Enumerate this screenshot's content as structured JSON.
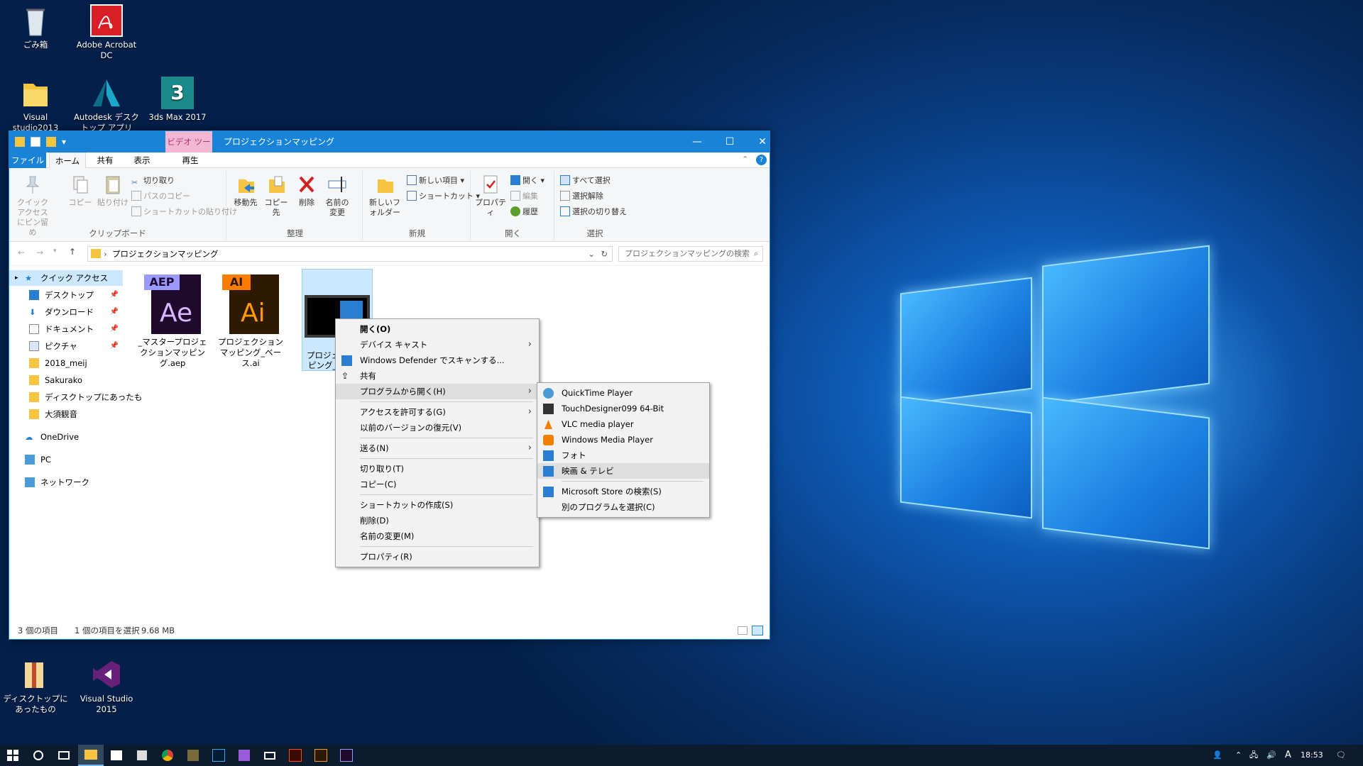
{
  "desktop": {
    "icons": [
      {
        "label": "ごみ箱",
        "icon": "recycle-bin-icon"
      },
      {
        "label": "Adobe Acrobat DC",
        "icon": "acrobat-icon"
      },
      {
        "label": "Visual studio2013",
        "icon": "folder-icon"
      },
      {
        "label": "Autodesk デスクトップ アプリ",
        "icon": "autodesk-icon"
      },
      {
        "label": "3ds Max 2017",
        "icon": "3dsmax-icon"
      },
      {
        "label": "ディスクトップにあったもの",
        "icon": "zip-folder-icon"
      },
      {
        "label": "Visual Studio 2015",
        "icon": "visual-studio-icon"
      }
    ]
  },
  "explorer": {
    "contextual_tab": "ビデオ ツール",
    "title": "プロジェクションマッピング",
    "tabs": [
      "ファイル",
      "ホーム",
      "共有",
      "表示",
      "再生"
    ],
    "ribbon": {
      "clipboard": {
        "label": "クリップボード",
        "pin": "クイック アクセスにピン留め",
        "copy": "コピー",
        "paste": "貼り付け",
        "cut": "切り取り",
        "copy_path": "パスのコピー",
        "paste_shortcut": "ショートカットの貼り付け"
      },
      "organize": {
        "label": "整理",
        "move_to": "移動先",
        "copy_to": "コピー先",
        "delete": "削除",
        "rename": "名前の変更"
      },
      "new": {
        "label": "新規",
        "new_folder": "新しいフォルダー",
        "new_item": "新しい項目",
        "shortcut": "ショートカット"
      },
      "open": {
        "label": "開く",
        "properties": "プロパティ",
        "open": "開く",
        "edit": "編集",
        "history": "履歴"
      },
      "select": {
        "label": "選択",
        "select_all": "すべて選択",
        "select_none": "選択解除",
        "invert": "選択の切り替え"
      }
    },
    "address": "プロジェクションマッピング",
    "search_placeholder": "プロジェクションマッピングの検索",
    "nav": [
      {
        "label": "クイック アクセス"
      },
      {
        "label": "デスクトップ"
      },
      {
        "label": "ダウンロード"
      },
      {
        "label": "ドキュメント"
      },
      {
        "label": "ピクチャ"
      },
      {
        "label": "2018_meij"
      },
      {
        "label": "Sakurako"
      },
      {
        "label": "ディスクトップにあったも"
      },
      {
        "label": "大須観音"
      },
      {
        "label": "OneDrive"
      },
      {
        "label": "PC"
      },
      {
        "label": "ネットワーク"
      }
    ],
    "files": [
      {
        "name": "_マスタープロジェクションマッピング.aep",
        "badge": "AEP",
        "glyph": "Ae"
      },
      {
        "name": "プロジェクションマッピング_ベース.ai",
        "badge": "AI",
        "glyph": "Ai"
      },
      {
        "name": "プロジェクションマッピング_マ...mov",
        "name_lines": [
          "プロジェクシ",
          "ピング_マ",
          "mo"
        ]
      }
    ],
    "status": {
      "count": "3 個の項目",
      "selected": "1 個の項目を選択",
      "size": "9.68 MB"
    }
  },
  "context_menu": [
    {
      "label": "開く(O)",
      "bold": true
    },
    {
      "label": "デバイス キャスト",
      "submenu": true
    },
    {
      "label": "Windows Defender でスキャンする...",
      "icon": "defender-icon"
    },
    {
      "label": "共有",
      "icon": "share-icon"
    },
    {
      "label": "プログラムから開く(H)",
      "submenu": true
    },
    {
      "label": "アクセスを許可する(G)",
      "submenu": true
    },
    {
      "label": "以前のバージョンの復元(V)"
    },
    {
      "label": "送る(N)",
      "submenu": true
    },
    {
      "label": "切り取り(T)"
    },
    {
      "label": "コピー(C)"
    },
    {
      "label": "ショートカットの作成(S)"
    },
    {
      "label": "削除(D)"
    },
    {
      "label": "名前の変更(M)"
    },
    {
      "label": "プロパティ(R)"
    }
  ],
  "submenu": [
    {
      "label": "QuickTime Player",
      "icon": "quicktime-icon"
    },
    {
      "label": "TouchDesigner099 64-Bit",
      "icon": "touchdesigner-icon"
    },
    {
      "label": "VLC media player",
      "icon": "vlc-icon"
    },
    {
      "label": "Windows Media Player",
      "icon": "wmp-icon"
    },
    {
      "label": "フォト",
      "icon": "photos-icon"
    },
    {
      "label": "映画 & テレビ",
      "icon": "movies-tv-icon"
    },
    {
      "label": "Microsoft Store の検索(S)",
      "icon": "store-icon"
    },
    {
      "label": "別のプログラムを選択(C)"
    }
  ],
  "taskbar": {
    "clock": "18:53",
    "ime": "A"
  },
  "colors": {
    "accent": "#1883d7",
    "selection": "#cce8ff"
  }
}
